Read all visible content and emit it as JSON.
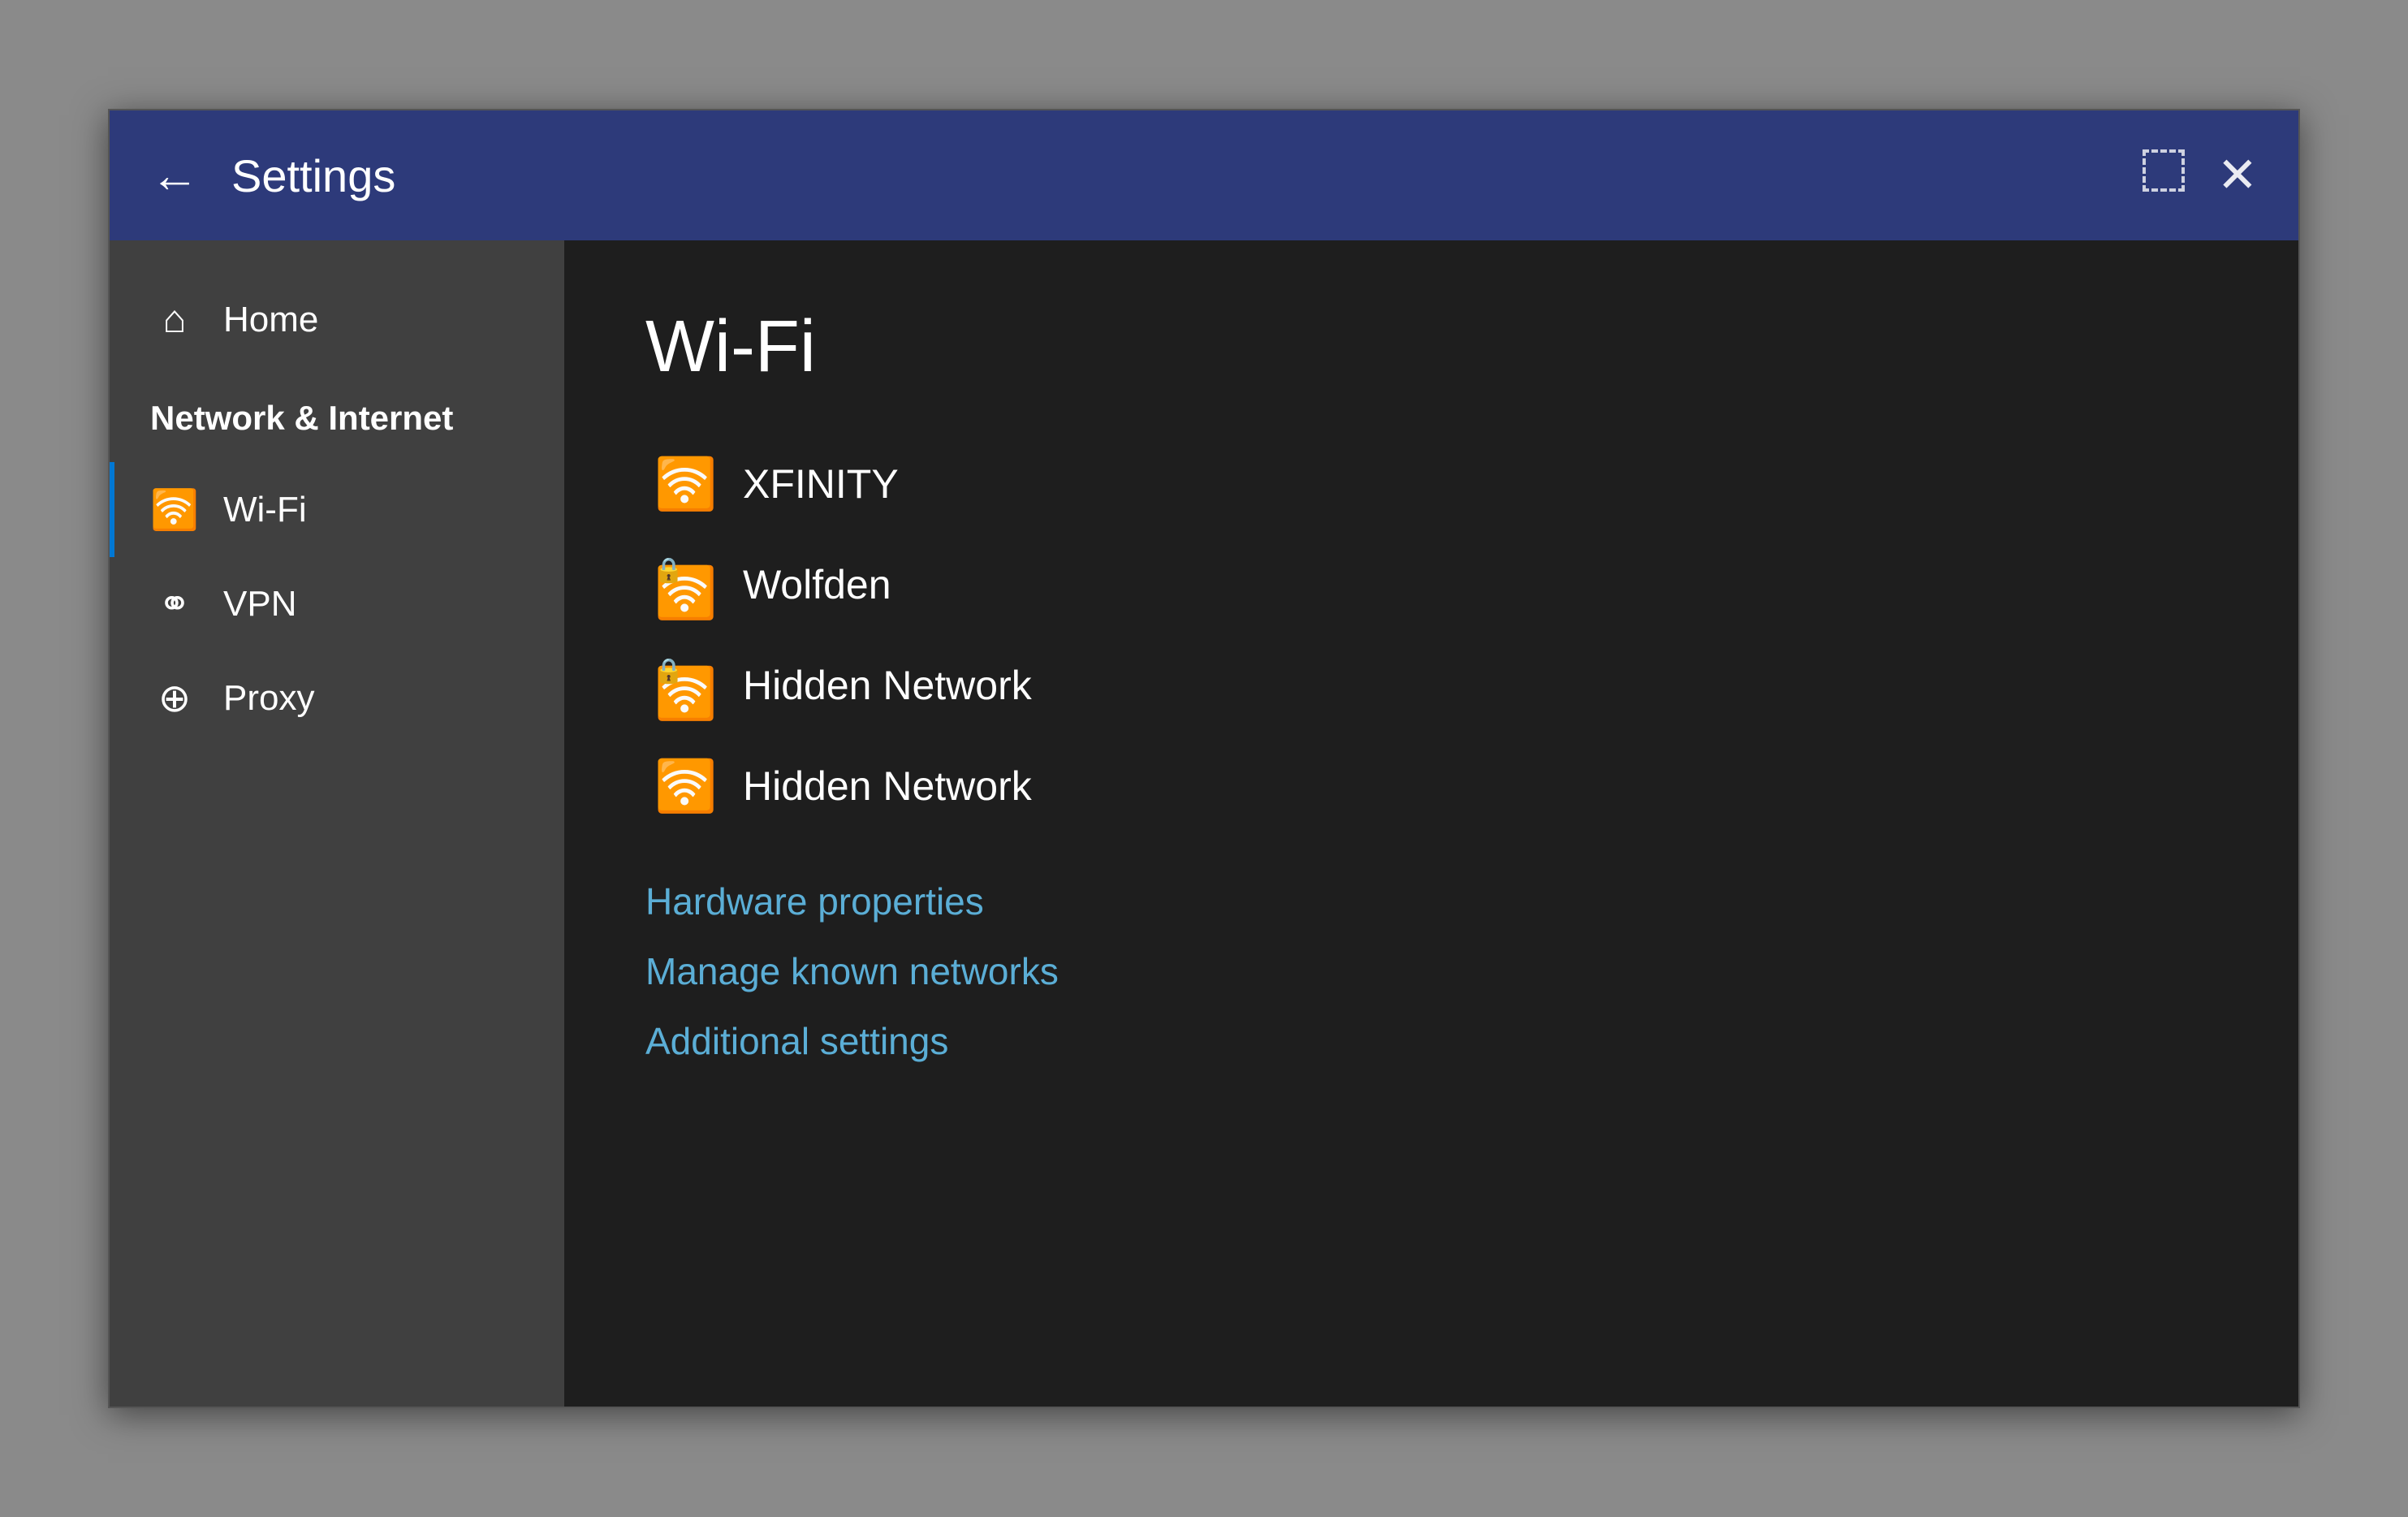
{
  "titlebar": {
    "title": "Settings",
    "back_label": "←",
    "restore_label": "⧉",
    "close_label": "✕"
  },
  "sidebar": {
    "home_label": "Home",
    "section_label": "Network & Internet",
    "items": [
      {
        "id": "wifi",
        "label": "Wi-Fi",
        "icon": "wifi",
        "active": true
      },
      {
        "id": "vpn",
        "label": "VPN",
        "icon": "vpn",
        "active": false
      },
      {
        "id": "proxy",
        "label": "Proxy",
        "icon": "proxy",
        "active": false
      }
    ]
  },
  "main": {
    "page_title": "Wi-Fi",
    "networks": [
      {
        "id": "xfinity",
        "name": "XFINITY",
        "secured": false
      },
      {
        "id": "wolfden",
        "name": "Wolfden",
        "secured": true
      },
      {
        "id": "hidden1",
        "name": "Hidden Network",
        "secured": true
      },
      {
        "id": "hidden2",
        "name": "Hidden Network",
        "secured": false
      }
    ],
    "links": [
      {
        "id": "hardware",
        "label": "Hardware properties"
      },
      {
        "id": "manage",
        "label": "Manage known networks"
      },
      {
        "id": "additional",
        "label": "Additional settings"
      }
    ]
  }
}
